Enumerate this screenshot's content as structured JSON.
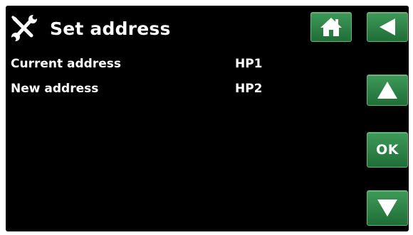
{
  "screen": {
    "title": "Set address",
    "title_icon": "tools-icon",
    "rows": [
      {
        "label": "Current address",
        "value": "HP1"
      },
      {
        "label": "New address",
        "value": "HP2"
      }
    ]
  },
  "buttons": {
    "home_icon": "home-icon",
    "back_icon": "back-arrow-icon",
    "up_icon": "up-arrow-icon",
    "ok_label": "OK",
    "down_icon": "down-arrow-icon"
  },
  "colors": {
    "background": "#000000",
    "button_green": "#2e8a48",
    "text": "#ffffff"
  }
}
